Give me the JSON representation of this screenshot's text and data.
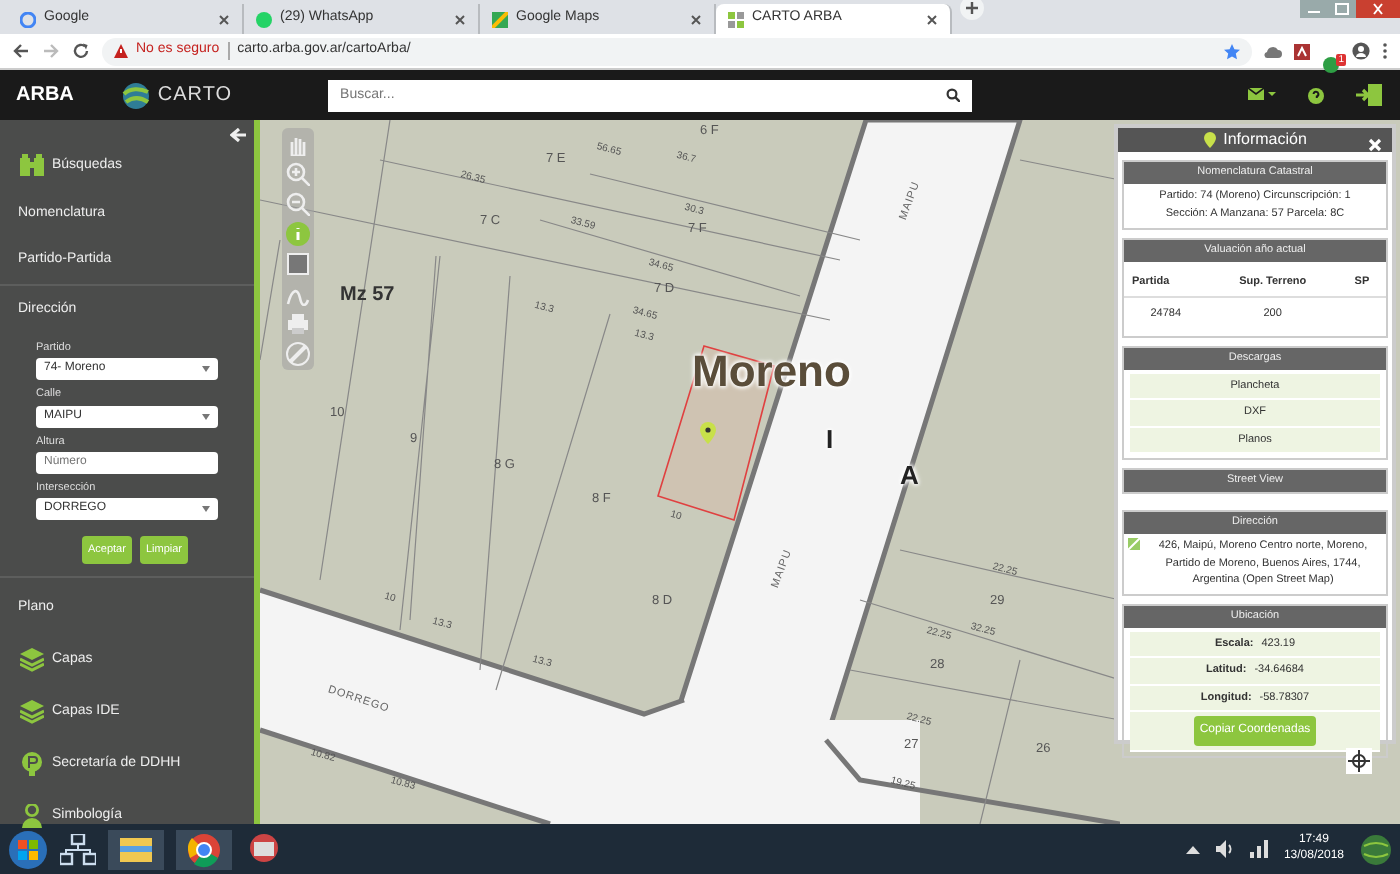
{
  "browser": {
    "tabs": [
      {
        "title": "Google",
        "selected": false
      },
      {
        "title": "(29) WhatsApp",
        "selected": false
      },
      {
        "title": "Google Maps",
        "selected": false
      },
      {
        "title": "CARTO ARBA",
        "selected": true
      }
    ],
    "security": "No es seguro",
    "url": "carto.arba.gov.ar/cartoArba/",
    "extension_badge": "1"
  },
  "app_header": {
    "logo": "ARBA",
    "brand": "CARTO",
    "search": {
      "placeholder": "Buscar..."
    }
  },
  "sidebar": {
    "search_items": [
      {
        "label": "Búsquedas",
        "kind": "binoculars"
      },
      {
        "label": "Nomenclatura",
        "kind": "plain"
      },
      {
        "label": "Partido-Partida",
        "kind": "plain"
      },
      {
        "label": "Dirección",
        "kind": "plain"
      }
    ],
    "form": {
      "fields": [
        {
          "label": "Partido",
          "kind": "select",
          "value": "74- Moreno"
        },
        {
          "label": "Calle",
          "kind": "select",
          "value": "MAIPU"
        },
        {
          "label": "Altura",
          "kind": "input",
          "placeholder": "Número"
        },
        {
          "label": "Intersección",
          "kind": "select",
          "value": "DORREGO"
        }
      ],
      "buttons": [
        "Aceptar",
        "Limpiar"
      ]
    },
    "plan_items": [
      {
        "label": "Plano",
        "kind": "plain"
      },
      {
        "label": "Capas",
        "kind": "layers"
      },
      {
        "label": "Capas IDE",
        "kind": "layers"
      },
      {
        "label": "Secretaría de DDHH",
        "kind": "badge"
      },
      {
        "label": "Simbología",
        "kind": "person"
      }
    ]
  },
  "map": {
    "labels": [
      {
        "text": "Moreno",
        "kind": "town"
      },
      {
        "text": "I",
        "kind": "big"
      },
      {
        "text": "A",
        "kind": "big"
      },
      {
        "text": "Mz 57",
        "kind": "block"
      },
      {
        "text": "MAIPU",
        "kind": "street"
      },
      {
        "text": "MAIPU",
        "kind": "street"
      },
      {
        "text": "DORREGO",
        "kind": "street"
      },
      {
        "text": "6 F",
        "kind": "lot"
      },
      {
        "text": "7 E",
        "kind": "lot"
      },
      {
        "text": "7 C",
        "kind": "lot"
      },
      {
        "text": "7 F",
        "kind": "lot"
      },
      {
        "text": "7 D",
        "kind": "lot"
      },
      {
        "text": "10",
        "kind": "lot"
      },
      {
        "text": "9",
        "kind": "lot"
      },
      {
        "text": "8 G",
        "kind": "lot"
      },
      {
        "text": "8 F",
        "kind": "lot"
      },
      {
        "text": "8 D",
        "kind": "lot"
      },
      {
        "text": "29",
        "kind": "lot"
      },
      {
        "text": "28",
        "kind": "lot"
      },
      {
        "text": "27",
        "kind": "lot"
      },
      {
        "text": "26",
        "kind": "lot"
      },
      {
        "text": "56.65",
        "kind": "dim"
      },
      {
        "text": "36.7",
        "kind": "dim"
      },
      {
        "text": "26.35",
        "kind": "dim"
      },
      {
        "text": "30.3",
        "kind": "dim"
      },
      {
        "text": "33.59",
        "kind": "dim"
      },
      {
        "text": "34.65",
        "kind": "dim"
      },
      {
        "text": "34.65",
        "kind": "dim"
      },
      {
        "text": "13.3",
        "kind": "dim"
      },
      {
        "text": "13.3",
        "kind": "dim"
      },
      {
        "text": "13.3",
        "kind": "dim"
      },
      {
        "text": "13.3",
        "kind": "dim"
      },
      {
        "text": "10",
        "kind": "dim"
      },
      {
        "text": "10",
        "kind": "dim"
      },
      {
        "text": "22.25",
        "kind": "dim"
      },
      {
        "text": "32.25",
        "kind": "dim"
      },
      {
        "text": "22.25",
        "kind": "dim"
      },
      {
        "text": "22.25",
        "kind": "dim"
      },
      {
        "text": "19.25",
        "kind": "dim"
      },
      {
        "text": "10.82",
        "kind": "dim"
      },
      {
        "text": "10.83",
        "kind": "dim"
      }
    ]
  },
  "info_panel": {
    "title": "Información",
    "nomenclatura": {
      "title": "Nomenclatura Catastral",
      "lines": [
        "Partido: 74 (Moreno) Circunscripción: 1",
        "Sección: A Manzana: 57 Parcela: 8C"
      ]
    },
    "valuacion": {
      "title": "Valuación año actual",
      "columns": [
        "Partida",
        "Sup. Terreno",
        "SP"
      ],
      "rows": [
        [
          "24784",
          "200",
          ""
        ]
      ]
    },
    "descargas": {
      "title": "Descargas",
      "links": [
        "Plancheta",
        "DXF",
        "Planos"
      ]
    },
    "street_view": {
      "title": "Street View"
    },
    "direccion": {
      "title": "Dirección",
      "text": "426, Maipú, Moreno Centro norte, Moreno, Partido de Moreno, Buenos Aires, 1744, Argentina (Open Street Map)"
    },
    "ubicacion": {
      "title": "Ubicación",
      "rows": [
        {
          "label": "Escala:",
          "value": "423.19"
        },
        {
          "label": "Latitud:",
          "value": "-34.64684"
        },
        {
          "label": "Longitud:",
          "value": "-58.78307"
        }
      ],
      "button": "Copiar Coordenadas"
    }
  },
  "taskbar": {
    "time": "17:49",
    "date": "13/08/2018"
  }
}
